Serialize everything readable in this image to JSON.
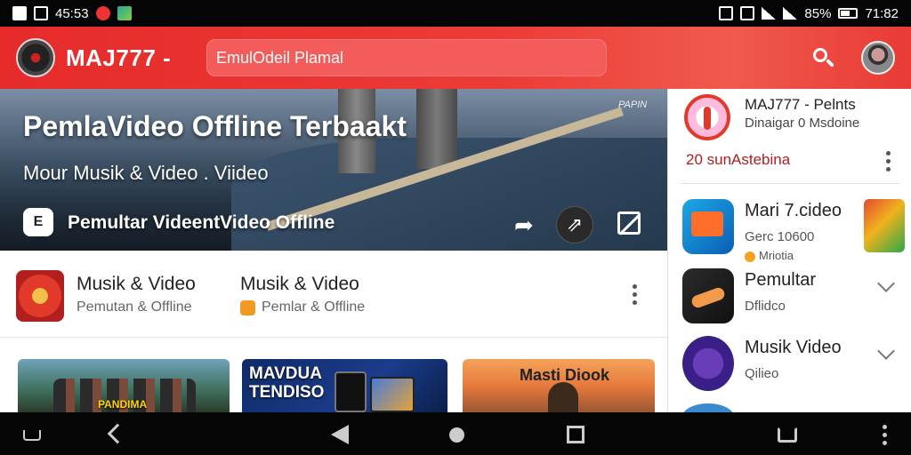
{
  "status_bar": {
    "time_left": "45:53",
    "battery": "85%",
    "time_right": "71:82"
  },
  "app_bar": {
    "title": "MAJ777 -",
    "search_placeholder": "EmulOdeil Plamal"
  },
  "hero": {
    "title": "PemlaVideo Offline Terbaakt",
    "subtitle": "Mour Musik & Video . Viideo",
    "tag": "PAPIN",
    "footer_icon_text": "E",
    "footer_text": "Pemultar VideentVideo Offline"
  },
  "row": {
    "item1_title": "Musik & Video",
    "item1_sub": "Pemutan & Offline",
    "item2_title": "Musik & Video",
    "item2_sub": "Pemlar & Offline"
  },
  "thumbs": {
    "a_label": "PANDIMA",
    "b_label": "MAVDUA TENDISO",
    "c_label": "Masti Diook"
  },
  "panel": {
    "header_title": "MAJ777 - Pelnts",
    "header_sub": "Dinaigar 0 Msdoine",
    "rating": "20 sunAstebina",
    "items": [
      {
        "title": "Mari 7.cideo",
        "sub": "Gerc 10600",
        "sub2": "Mriotia"
      },
      {
        "title": "Pemultar",
        "sub": "Dflidco"
      },
      {
        "title": "Musik Video",
        "sub": "Qilieo"
      }
    ]
  },
  "colors": {
    "accent": "#e52b2b",
    "accent_light": "#f45b5b",
    "rating_red": "#b01e1e"
  }
}
